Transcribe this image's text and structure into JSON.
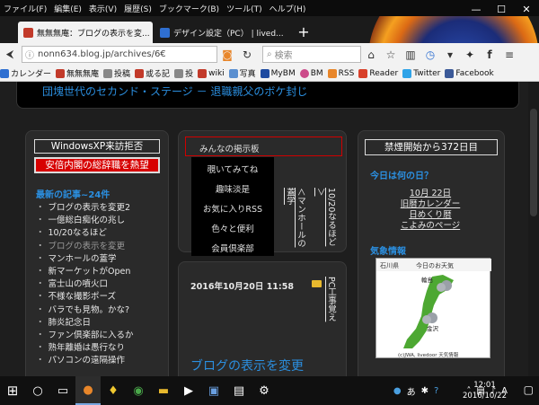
{
  "menubar": [
    "ファイル(F)",
    "編集(E)",
    "表示(V)",
    "履歴(S)",
    "ブックマーク(B)",
    "ツール(T)",
    "ヘルプ(H)"
  ],
  "tabs": [
    {
      "label": "無無無庵：ブログの表示を変...",
      "active": true
    },
    {
      "label": "デザイン設定（PC） | lived...",
      "active": false
    }
  ],
  "url": "nonn634.blog.jp/archives/6€",
  "search_placeholder": "検索",
  "bookmarks": [
    "カレンダー",
    "無無無庵",
    "投稿",
    "或る記",
    "投",
    "wiki",
    "写真",
    "MyBM",
    "BM",
    "RSS",
    "Reader",
    "Twitter",
    "Facebook"
  ],
  "header_title": "団塊世代のセカンド・ステージ － 退職親父のボケ封じ",
  "left": {
    "winxp": "WindowsXP来訪拒否",
    "abe": "安倍内閣の総辞職を熱望",
    "recent_title": "最新の記事~24件",
    "recent": [
      {
        "label": "ブログの表示を変更2",
        "visited": false
      },
      {
        "label": "一億総白痴化の兆し",
        "visited": false
      },
      {
        "label": "10/20なるほど",
        "visited": false
      },
      {
        "label": "ブログの表示を変更",
        "visited": true
      },
      {
        "label": "マンホールの蓋学",
        "visited": false
      },
      {
        "label": "新マーケットがOpen",
        "visited": false
      },
      {
        "label": "富士山の噴火口",
        "visited": false
      },
      {
        "label": "不様な撮影ポーズ",
        "visited": false
      },
      {
        "label": "バラでも見物。かな?",
        "visited": false
      },
      {
        "label": "肺炎記念日",
        "visited": false
      },
      {
        "label": "ファン倶楽部に入るか",
        "visited": false
      },
      {
        "label": "熟年離婚は愚行なり",
        "visited": false
      },
      {
        "label": "パソコンの遠隔操作",
        "visited": false
      }
    ]
  },
  "middle": {
    "menu_first": "みんなの掲示板",
    "dropdown": [
      "覗いてみてね",
      "趣味淡是",
      "お気に入りRSS",
      "色々と便利",
      "会員倶楽部"
    ],
    "vlink1": "＜マンホールの蓋学",
    "vlink2": "10/20なるほど＞",
    "post_date": "2016年10月20日 11:58",
    "post_category": "PC工事覚え",
    "post_title": "ブログの表示を変更"
  },
  "right": {
    "ban": "禁煙開始から372日目",
    "today_title": "今日は何の日？",
    "date_link": "10月 22日",
    "links": [
      "旧暦カレンダー",
      "日めくり暦",
      "こよみのページ"
    ],
    "weather_title": "気象情報",
    "weather": {
      "pref": "石川県",
      "caption": "今日のお天気",
      "city1": "輪島",
      "city2": "金沢",
      "credit": "(c)JWA, livedoor 天気情報"
    }
  },
  "taskbar": {
    "time": "12:01",
    "date": "2016/10/22",
    "ime": "あ"
  }
}
